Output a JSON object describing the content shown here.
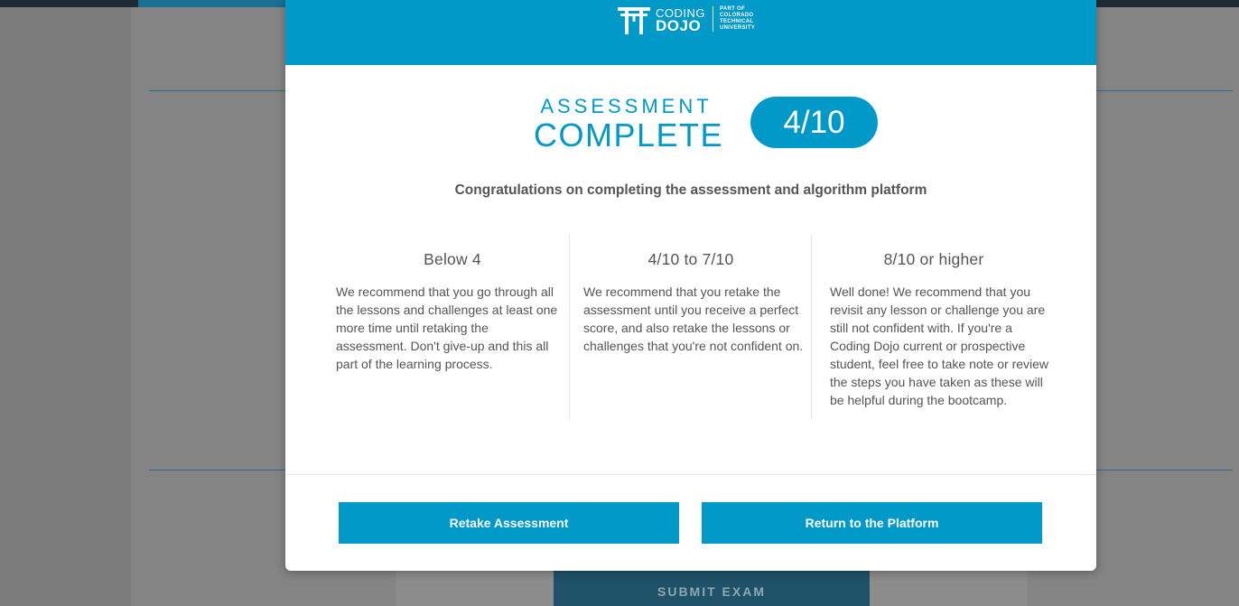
{
  "background": {
    "submit_label": "SUBMIT EXAM"
  },
  "modal": {
    "logo": {
      "coding": "CODING",
      "dojo": "DOJO",
      "affiliation": [
        "PART OF",
        "COLORADO",
        "TECHNICAL",
        "UNIVERSITY"
      ]
    },
    "title_line1": "ASSESSMENT",
    "title_line2": "COMPLETE",
    "score": "4/10",
    "congrats": "Congratulations on completing the assessment and algorithm platform",
    "columns": [
      {
        "heading": "Below 4",
        "text": "We recommend that you go through all the lessons and challenges at least one more time until retaking the assessment. Don't give-up and this all part of the learning process."
      },
      {
        "heading": "4/10 to 7/10",
        "text": "We recommend that you retake the assessment until you receive a perfect score, and also retake the lessons or challenges that you're not confident on."
      },
      {
        "heading": "8/10 or higher",
        "text": "Well done! We recommend that you revisit any lesson or challenge you are still not confident with. If you're a Coding Dojo current or prospective student, feel free to take note or review the steps you have taken as these will be helpful during the bootcamp."
      }
    ],
    "buttons": {
      "retake": "Retake Assessment",
      "return": "Return to the Platform"
    }
  },
  "colors": {
    "brand": "#0199c8",
    "text": "#555555",
    "overlay": "#7b7b7b"
  },
  "icons": {
    "logo": "torii-gate-icon"
  }
}
